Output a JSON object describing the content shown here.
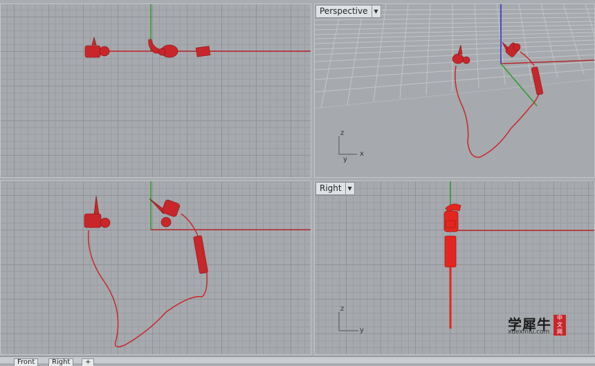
{
  "viewports": {
    "top": {
      "title": ""
    },
    "perspective": {
      "title": "Perspective"
    },
    "front": {
      "title": ""
    },
    "right": {
      "title": "Right"
    }
  },
  "axis_labels": {
    "x": "x",
    "y": "y",
    "z": "z"
  },
  "tabs": [
    "Front",
    "Right",
    "+"
  ],
  "watermark": {
    "text": "学犀牛",
    "url": "xuexiniu.com",
    "seal": [
      "中",
      "文",
      "网"
    ]
  },
  "colors": {
    "model": "#c8262b",
    "x_axis": "#b3262b",
    "y_axis": "#2d9a2d",
    "z_axis": "#2b2bd0",
    "grid": "#8f9397"
  }
}
